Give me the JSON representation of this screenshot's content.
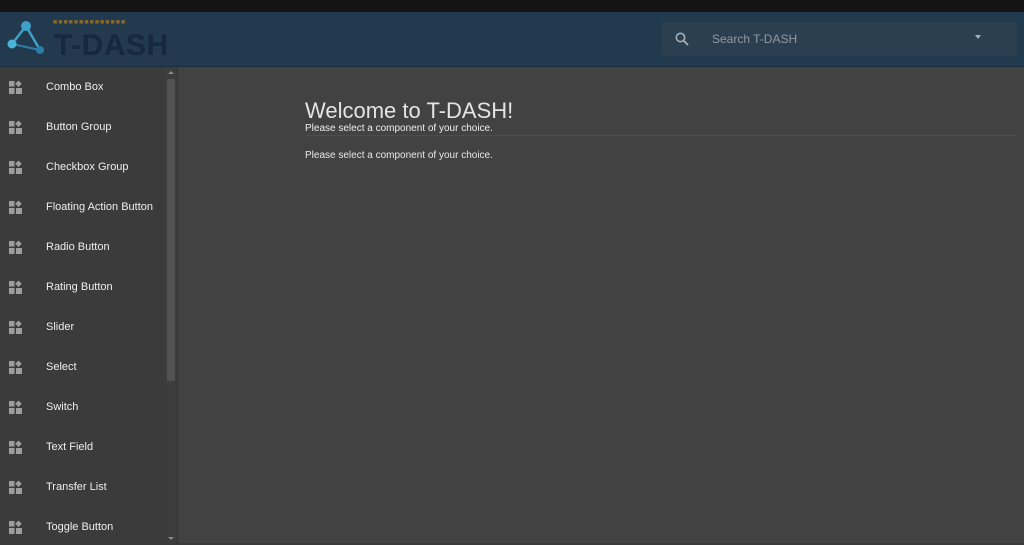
{
  "app": {
    "title": "T-DASH",
    "tagline": "■■■■■■■■■■■■■■"
  },
  "search": {
    "placeholder": "Search T-DASH"
  },
  "sidebar": {
    "items": [
      {
        "label": "Combo Box",
        "icon": "widgets-icon"
      },
      {
        "label": "Button Group",
        "icon": "widgets-icon"
      },
      {
        "label": "Checkbox Group",
        "icon": "widgets-icon"
      },
      {
        "label": "Floating Action Button",
        "icon": "widgets-icon"
      },
      {
        "label": "Radio Button",
        "icon": "widgets-icon"
      },
      {
        "label": "Rating Button",
        "icon": "widgets-icon"
      },
      {
        "label": "Slider",
        "icon": "widgets-icon"
      },
      {
        "label": "Select",
        "icon": "widgets-icon"
      },
      {
        "label": "Switch",
        "icon": "widgets-icon"
      },
      {
        "label": "Text Field",
        "icon": "widgets-icon"
      },
      {
        "label": "Transfer List",
        "icon": "widgets-icon"
      },
      {
        "label": "Toggle Button",
        "icon": "widgets-icon"
      }
    ]
  },
  "main": {
    "title": "Welcome to T-DASH!",
    "subtitle": "Please select a component of your choice.",
    "body": "Please select a component of your choice."
  },
  "colors": {
    "appbar": "#22394e",
    "sidebar": "#3b3b3b",
    "main": "#424242",
    "logo_accent": "#3fa0c8"
  }
}
